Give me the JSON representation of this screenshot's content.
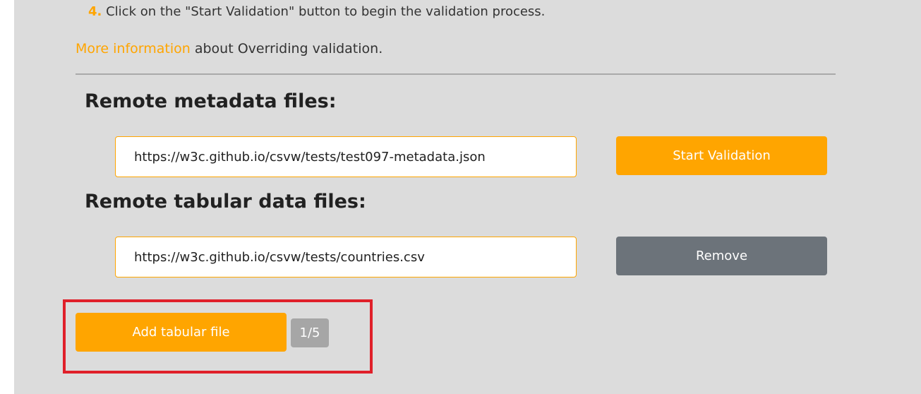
{
  "instructions": {
    "step_number": "4.",
    "step_text": " Click on the \"Start Validation\" button to begin the validation process.",
    "more_info_link": "More information",
    "more_info_suffix": " about Overriding validation."
  },
  "metadata_section": {
    "title": "Remote metadata files:",
    "url_value": "https://w3c.github.io/csvw/tests/test097-metadata.json",
    "start_button_label": "Start Validation"
  },
  "tabular_section": {
    "title": "Remote tabular data files:",
    "url_value": "https://w3c.github.io/csvw/tests/countries.csv",
    "remove_button_label": "Remove",
    "add_button_label": "Add tabular file",
    "count_badge": "1/5"
  },
  "colors": {
    "accent": "#ffa500",
    "panel_bg": "#dcdcdc",
    "remove_button": "#6c737a",
    "badge": "#a6a6a6",
    "highlight": "#e0202a"
  }
}
